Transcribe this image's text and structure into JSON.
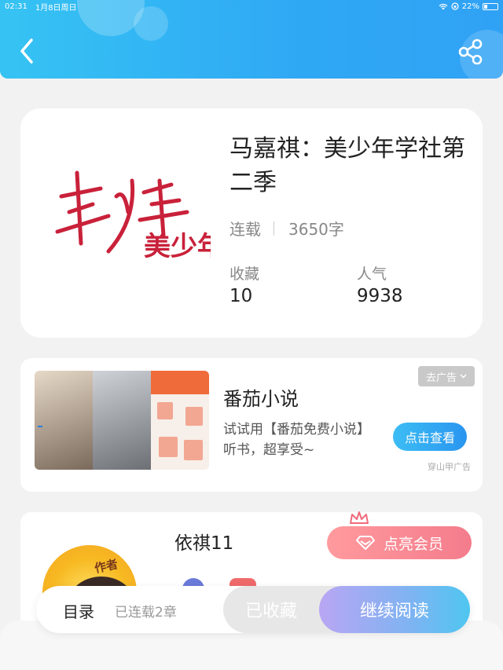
{
  "status_bar": {
    "time": "02:31",
    "date": "1月8日周日",
    "battery": "22%",
    "battery_level": 0.22
  },
  "header": {
    "back_icon": "chevron-left-icon",
    "share_icon": "share-icon"
  },
  "book": {
    "cover_text": "美少年学社",
    "title": "马嘉祺：美少年学社第二季",
    "status": "连载",
    "word_count": "3650字",
    "favorites_label": "收藏",
    "favorites_value": "10",
    "popularity_label": "人气",
    "popularity_value": "9938"
  },
  "ad": {
    "name": "番茄小说",
    "description": "试试用【番茄免费小说】听书，超享受~",
    "remove_label": "去广告",
    "cta_label": "点击查看",
    "source": "穿山甲广告"
  },
  "author": {
    "name": "依祺11",
    "tag": "作者",
    "vip_label": "点亮会员"
  },
  "bottom_bar": {
    "toc_label": "目录",
    "chapter_count": "已连载2章",
    "collected_label": "已收藏",
    "continue_label": "继续阅读"
  },
  "colors": {
    "header_blue": "#2fa8f4",
    "vip_pink": "#f47c8c",
    "accent_blue": "#2a95f0"
  }
}
